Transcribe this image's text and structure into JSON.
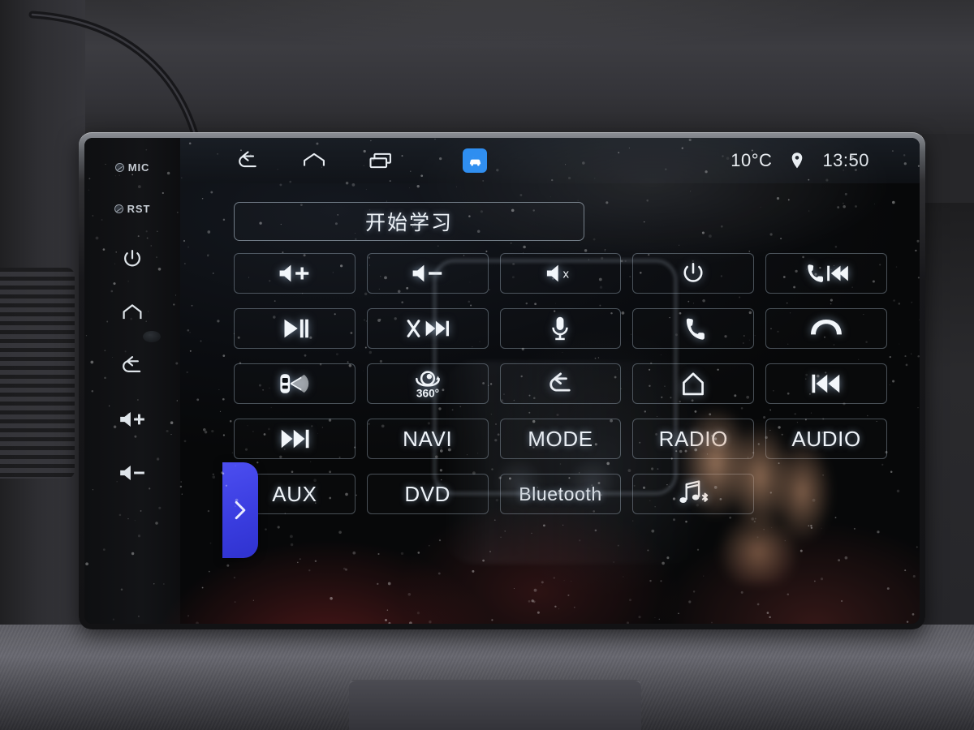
{
  "device": {
    "name": "android-car-head-unit",
    "bezel_keys": [
      {
        "id": "mic",
        "label": "MIC",
        "icon": "microphone-pinhole-icon"
      },
      {
        "id": "rst",
        "label": "RST",
        "icon": "reset-pinhole-icon"
      },
      {
        "id": "power",
        "label": "",
        "icon": "power-icon"
      },
      {
        "id": "home",
        "label": "",
        "icon": "home-icon"
      },
      {
        "id": "back",
        "label": "",
        "icon": "back-arrow-icon"
      },
      {
        "id": "volume-up",
        "label": "",
        "icon": "volume-up-icon"
      },
      {
        "id": "volume-down",
        "label": "",
        "icon": "volume-down-icon"
      }
    ]
  },
  "statusbar": {
    "nav": [
      {
        "id": "back",
        "icon": "back-arrow-icon"
      },
      {
        "id": "home",
        "icon": "home-icon"
      },
      {
        "id": "recents",
        "icon": "recent-apps-icon"
      },
      {
        "id": "car-app",
        "icon": "car-cloud-icon",
        "color": "#2b8cf0"
      }
    ],
    "temperature": "10°C",
    "location_icon": "location-pin-icon",
    "clock": "13:50"
  },
  "main": {
    "learn_button_label": "开始学习",
    "grid": [
      [
        {
          "id": "volume-up",
          "type": "icon",
          "icon": "volume-up-icon",
          "label": ""
        },
        {
          "id": "volume-down",
          "type": "icon",
          "icon": "volume-down-icon",
          "label": ""
        },
        {
          "id": "mute",
          "type": "icon",
          "icon": "volume-mute-icon",
          "label": ""
        },
        {
          "id": "power",
          "type": "icon",
          "icon": "power-icon",
          "label": ""
        },
        {
          "id": "call-previous",
          "type": "icon",
          "icon": "phone-previous-icon",
          "label": ""
        }
      ],
      [
        {
          "id": "play-pause",
          "type": "icon",
          "icon": "play-pause-icon",
          "label": ""
        },
        {
          "id": "mute-next",
          "type": "icon",
          "icon": "mute-next-track-icon",
          "label": ""
        },
        {
          "id": "voice",
          "type": "icon",
          "icon": "microphone-icon",
          "label": ""
        },
        {
          "id": "call-answer",
          "type": "icon",
          "icon": "phone-answer-icon",
          "label": ""
        },
        {
          "id": "call-hangup",
          "type": "icon",
          "icon": "phone-hangup-icon",
          "label": ""
        }
      ],
      [
        {
          "id": "parking-radar",
          "type": "icon",
          "icon": "car-radar-icon",
          "label": ""
        },
        {
          "id": "camera-360",
          "type": "icon",
          "icon": "camera-360-icon",
          "label": "360°"
        },
        {
          "id": "back",
          "type": "icon",
          "icon": "back-arrow-icon",
          "label": ""
        },
        {
          "id": "home",
          "type": "icon",
          "icon": "home-icon",
          "label": ""
        },
        {
          "id": "previous-track",
          "type": "icon",
          "icon": "previous-track-icon",
          "label": ""
        }
      ],
      [
        {
          "id": "next-track",
          "type": "icon",
          "icon": "next-track-icon",
          "label": ""
        },
        {
          "id": "navi",
          "type": "text",
          "icon": "",
          "label": "NAVI"
        },
        {
          "id": "mode",
          "type": "text",
          "icon": "",
          "label": "MODE"
        },
        {
          "id": "radio",
          "type": "text",
          "icon": "",
          "label": "RADIO"
        },
        {
          "id": "audio",
          "type": "text",
          "icon": "",
          "label": "AUDIO"
        }
      ],
      [
        {
          "id": "aux",
          "type": "text",
          "icon": "",
          "label": "AUX"
        },
        {
          "id": "dvd",
          "type": "text",
          "icon": "",
          "label": "DVD"
        },
        {
          "id": "bluetooth",
          "type": "text-small",
          "icon": "",
          "label": "Bluetooth"
        },
        {
          "id": "bluetooth-music",
          "type": "icon",
          "icon": "bluetooth-music-icon",
          "label": ""
        },
        {
          "id": "empty",
          "type": "blank",
          "icon": "",
          "label": ""
        }
      ]
    ]
  },
  "overlays": {
    "side_tab": {
      "icon": "chevron-right-icon",
      "color": "#3a3de0"
    },
    "mic_fab": {
      "icon": "microphone-icon",
      "color": "#2196f3"
    },
    "settings": {
      "icon": "gear-icon"
    }
  }
}
